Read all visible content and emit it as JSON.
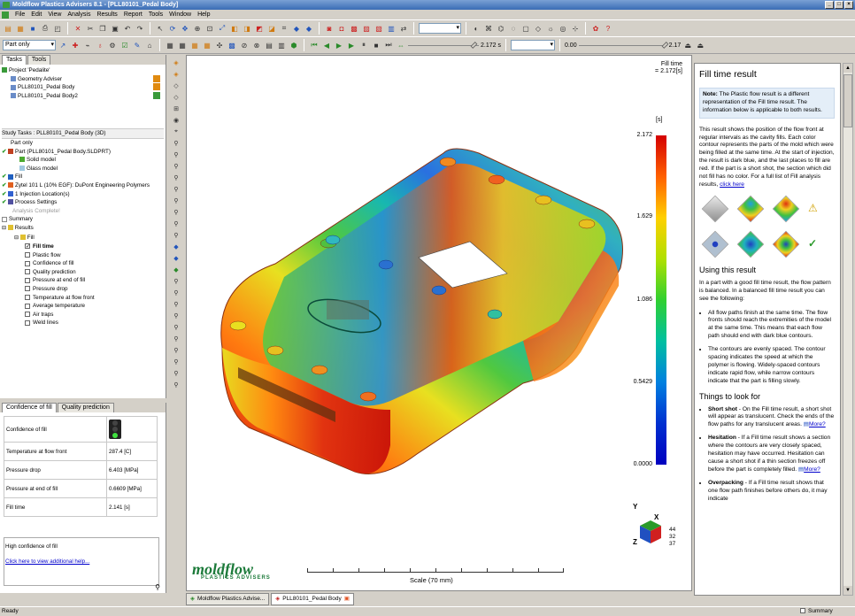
{
  "window": {
    "title": "Moldflow Plastics Advisers 8.1 - [PLL80101_Pedal Body]"
  },
  "menu": [
    "File",
    "Edit",
    "View",
    "Analysis",
    "Results",
    "Report",
    "Tools",
    "Window",
    "Help"
  ],
  "toolbar2": {
    "part_combo": "Part only",
    "time_value": "2.172 s",
    "range_start": "0.00",
    "range_end": "2.17"
  },
  "tasks_panel": {
    "tabs": [
      "Tasks",
      "Tools"
    ],
    "project": {
      "label": "Project 'Pedalite'",
      "items": [
        "Geometry Adviser",
        "PLL80101_Pedal Body",
        "PLL80101_Pedal Body2"
      ]
    },
    "study": {
      "header": "Study Tasks : PLL80101_Pedal Body (3D)",
      "part_only": "Part only",
      "part": "Part (PLL80101_Pedal Body.SLDPRT)",
      "solid_model": "Solid model",
      "glass_model": "Glass model",
      "fill": "Fill",
      "material": "Zytel 101 L (10% EGF): DuPont Engineering Polymers",
      "injection": "1 Injection Location(s)",
      "process": "Process Settings",
      "analysis": "Analysis Complete!",
      "summary": "Summary",
      "results": "Results",
      "results_fill": "Fill",
      "result_items": [
        {
          "label": "Fill time",
          "checked": true,
          "bold": true
        },
        {
          "label": "Plastic flow",
          "checked": false
        },
        {
          "label": "Confidence of fill",
          "checked": false
        },
        {
          "label": "Quality prediction",
          "checked": false
        },
        {
          "label": "Pressure at end of fill",
          "checked": false
        },
        {
          "label": "Pressure drop",
          "checked": false
        },
        {
          "label": "Temperature at flow front",
          "checked": false
        },
        {
          "label": "Average temperature",
          "checked": false
        },
        {
          "label": "Air traps",
          "checked": false
        },
        {
          "label": "Weld lines",
          "checked": false
        }
      ]
    }
  },
  "properties_panel": {
    "tabs": [
      "Confidence of fill",
      "Quality prediction"
    ],
    "rows": [
      {
        "label": "Confidence of fill",
        "value": ""
      },
      {
        "label": "Temperature at flow front",
        "value": "287.4 [C]"
      },
      {
        "label": "Pressure drop",
        "value": "6.403 [MPa]"
      },
      {
        "label": "Pressure at end of fill",
        "value": "0.6609 [MPa]"
      },
      {
        "label": "Fill time",
        "value": "2.141 [s]"
      }
    ],
    "status": "High confidence of fill",
    "link": "Click here to view additional help..."
  },
  "viewport": {
    "title_line1": "Fill time",
    "title_line2": "= 2.172[s]",
    "unit": "[s]",
    "ticks": [
      "2.172",
      "1.629",
      "1.086",
      "0.5429",
      "0.0000"
    ],
    "axis_x": "X",
    "axis_y": "Y",
    "axis_z": "Z",
    "angles": [
      "44",
      "32",
      "37"
    ],
    "logo_main": "moldflow",
    "logo_sub": "PLASTICS ADVISERS",
    "scale_label": "Scale (70 mm)"
  },
  "help": {
    "title": "Fill time result",
    "note_bold": "Note:",
    "note_text": " The Plastic flow result is a different representation of the Fill time result. The information below is applicable to both results.",
    "intro": "This result shows the position of the flow front at regular intervals as the cavity fills. Each color contour represents the parts of the mold which were being filled at the same time. At the start of injection, the result is dark blue, and the last places to fill are red. If the part is a short shot, the section which did not fill has no color. For a full list of Fill analysis results, ",
    "intro_link": "click here",
    "using_title": "Using this result",
    "using_text": "In a part with a good fill time result, the flow pattern is balanced. In a balanced fill time result you can see the following:",
    "bullets": [
      "All flow paths finish at the same time. The flow fronts should reach the extremities of the model at the same time. This means that each flow path should end with dark blue contours.",
      "The contours are evenly spaced. The contour spacing indicates the speed at which the polymer is flowing. Widely-spaced contours indicate rapid flow, while narrow contours indicate that the part is filling slowly."
    ],
    "look_title": "Things to look for",
    "look_items": [
      {
        "head": "Short shot",
        "text": " - On the Fill time result, a short shot will appear as translucent. Check the ends of the flow paths for any translucent areas. ",
        "more": "More?"
      },
      {
        "head": "Hesitation",
        "text": " - If a Fill time result shows a section where the contours are very closely spaced, hesitation may have occurred. Hesitation can cause a short shot if a thin section freezes off before the part is completely filled. ",
        "more": "More?"
      },
      {
        "head": "Overpacking",
        "text": " - If a Fill time result shows that one flow path finishes before others do, it may indicate",
        "more": ""
      }
    ]
  },
  "doc_tabs": [
    "Moldflow Plastics Advise...",
    "PLL80101_Pedal Body"
  ],
  "status": {
    "left": "Ready",
    "right": "Summary"
  },
  "colors": {
    "accent": "#3a6db5",
    "brand_green": "#1c7a3a"
  }
}
